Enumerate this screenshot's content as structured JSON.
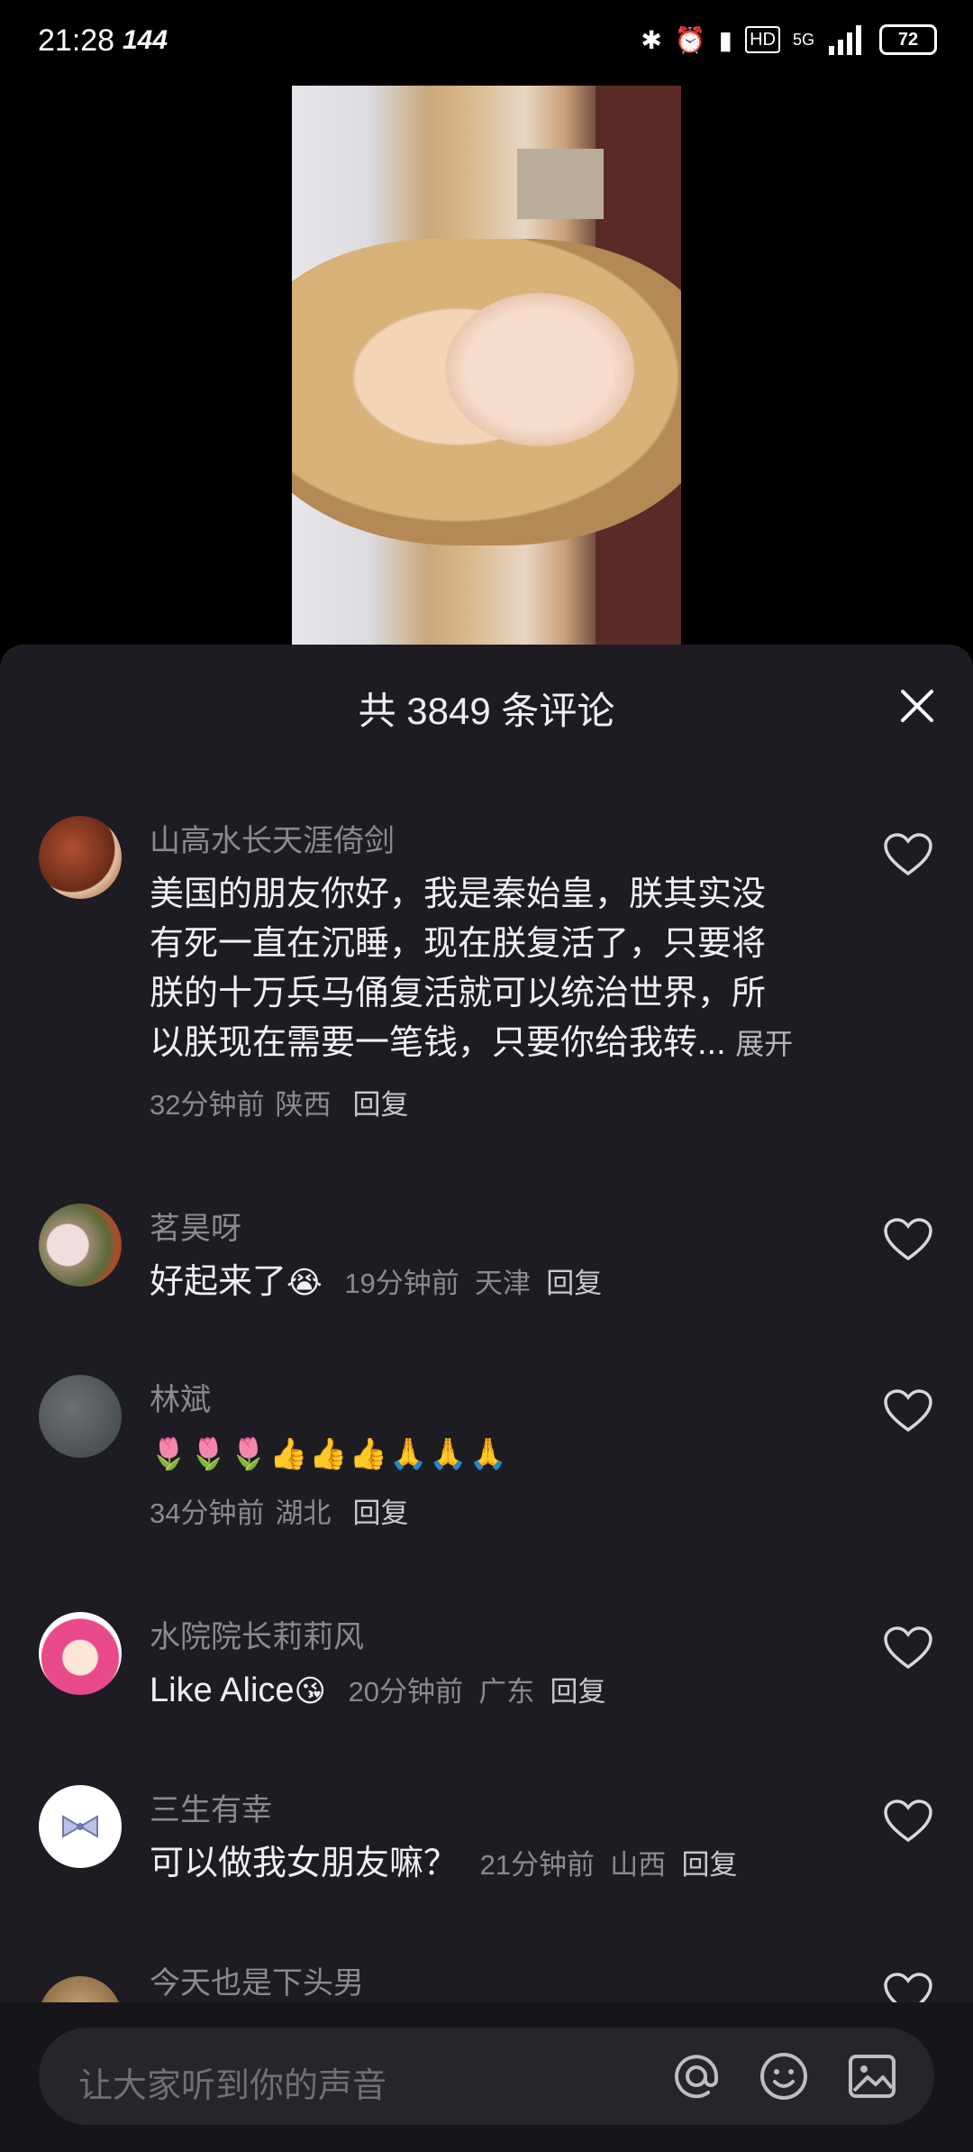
{
  "status_bar": {
    "time": "21:28",
    "refresh_rate": "144",
    "battery": "72",
    "network": "5G"
  },
  "panel": {
    "title": "共 3849 条评论"
  },
  "comments": [
    {
      "username": "山高水长天涯倚剑",
      "text": "美国的朋友你好，我是秦始皇，朕其实没有死一直在沉睡，现在朕复活了，只要将朕的十万兵马俑复活就可以统治世界，所以朕现在需要一笔钱，只要你给我转...",
      "line1": "美国的朋友你好，我是秦始皇，朕其实没",
      "line2": "有死一直在沉睡，现在朕复活了，只要将",
      "line3": "朕的十万兵马俑复活就可以统治世界，所",
      "line4": "以朕现在需要一笔钱，只要你给我转...",
      "expand": "展开",
      "time": "32分钟前",
      "location": "陕西",
      "reply": "回复"
    },
    {
      "username": "茗昊呀",
      "text": "好起来了",
      "emoji": "😭",
      "time": "19分钟前",
      "location": "天津",
      "reply": "回复"
    },
    {
      "username": "林斌",
      "emojis": "🌷🌷🌷👍👍👍🙏🙏🙏",
      "time": "34分钟前",
      "location": "湖北",
      "reply": "回复"
    },
    {
      "username": "水院院长莉莉风",
      "text": "Like Alice",
      "emoji": "😘",
      "time": "20分钟前",
      "location": "广东",
      "reply": "回复"
    },
    {
      "username": "三生有幸",
      "text": "可以做我女朋友嘛？",
      "time": "21分钟前",
      "location": "山西",
      "reply": "回复"
    },
    {
      "username": "今天也是下头男"
    }
  ],
  "input": {
    "placeholder": "让大家听到你的声音"
  },
  "colors": {
    "panel_bg": "#1d1c22",
    "meta_text": "#8a8a90"
  }
}
